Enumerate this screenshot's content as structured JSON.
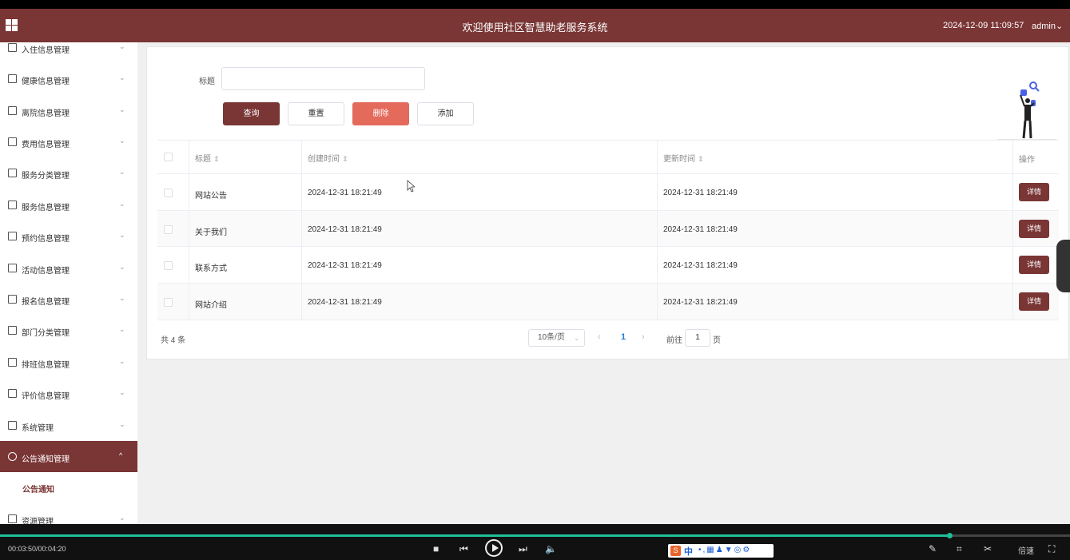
{
  "header": {
    "title": "欢迎使用社区智慧助老服务系统",
    "datetime": "2024-12-09 11:09:57",
    "user": "admin",
    "user_chevron": "⌄"
  },
  "sidebar": {
    "items": [
      {
        "label": "入住信息管理",
        "chevron": "⌄"
      },
      {
        "label": "健康信息管理",
        "chevron": "⌄"
      },
      {
        "label": "离院信息管理",
        "chevron": "⌄"
      },
      {
        "label": "费用信息管理",
        "chevron": "⌄"
      },
      {
        "label": "服务分类管理",
        "chevron": "⌄"
      },
      {
        "label": "服务信息管理",
        "chevron": "⌄"
      },
      {
        "label": "预约信息管理",
        "chevron": "⌄"
      },
      {
        "label": "活动信息管理",
        "chevron": "⌄"
      },
      {
        "label": "报名信息管理",
        "chevron": "⌄"
      },
      {
        "label": "部门分类管理",
        "chevron": "⌄"
      },
      {
        "label": "排班信息管理",
        "chevron": "⌄"
      },
      {
        "label": "评价信息管理",
        "chevron": "⌄"
      },
      {
        "label": "系统管理",
        "chevron": "⌄"
      },
      {
        "label": "公告通知管理",
        "chevron": "^"
      },
      {
        "label": "资源管理",
        "chevron": "⌄"
      }
    ],
    "active_index": 13,
    "submenu_label": "公告通知"
  },
  "search": {
    "label": "标题",
    "value": "",
    "placeholder": ""
  },
  "buttons": {
    "query": "查询",
    "reset": "重置",
    "delete": "删除",
    "add": "添加"
  },
  "table": {
    "headers": [
      "标题",
      "创建时间",
      "更新时间",
      "操作"
    ],
    "sort_glyph": "⇕",
    "rows": [
      {
        "title": "网站公告",
        "created": "2024-12-31 18:21:49",
        "updated": "2024-12-31 18:21:49",
        "action": "详情"
      },
      {
        "title": "关于我们",
        "created": "2024-12-31 18:21:49",
        "updated": "2024-12-31 18:21:49",
        "action": "详情"
      },
      {
        "title": "联系方式",
        "created": "2024-12-31 18:21:49",
        "updated": "2024-12-31 18:21:49",
        "action": "详情"
      },
      {
        "title": "网站介绍",
        "created": "2024-12-31 18:21:49",
        "updated": "2024-12-31 18:21:49",
        "action": "详情"
      }
    ]
  },
  "pagination": {
    "total": "共 4 条",
    "page_size": "10条/页",
    "prev": "‹",
    "current_page": "1",
    "next": "›",
    "goto_label": "前往",
    "goto_value": "1",
    "page_suffix": "页"
  },
  "player": {
    "time": "00:03:50/00:04:20",
    "progress": 0.888,
    "speed_label": "倍速",
    "ime_zh": "中",
    "ime_logo": "S"
  },
  "colors": {
    "brand": "#7a3535",
    "danger": "#e46a5b",
    "progress": "#1fbf9a",
    "link": "#1e7ad8"
  }
}
